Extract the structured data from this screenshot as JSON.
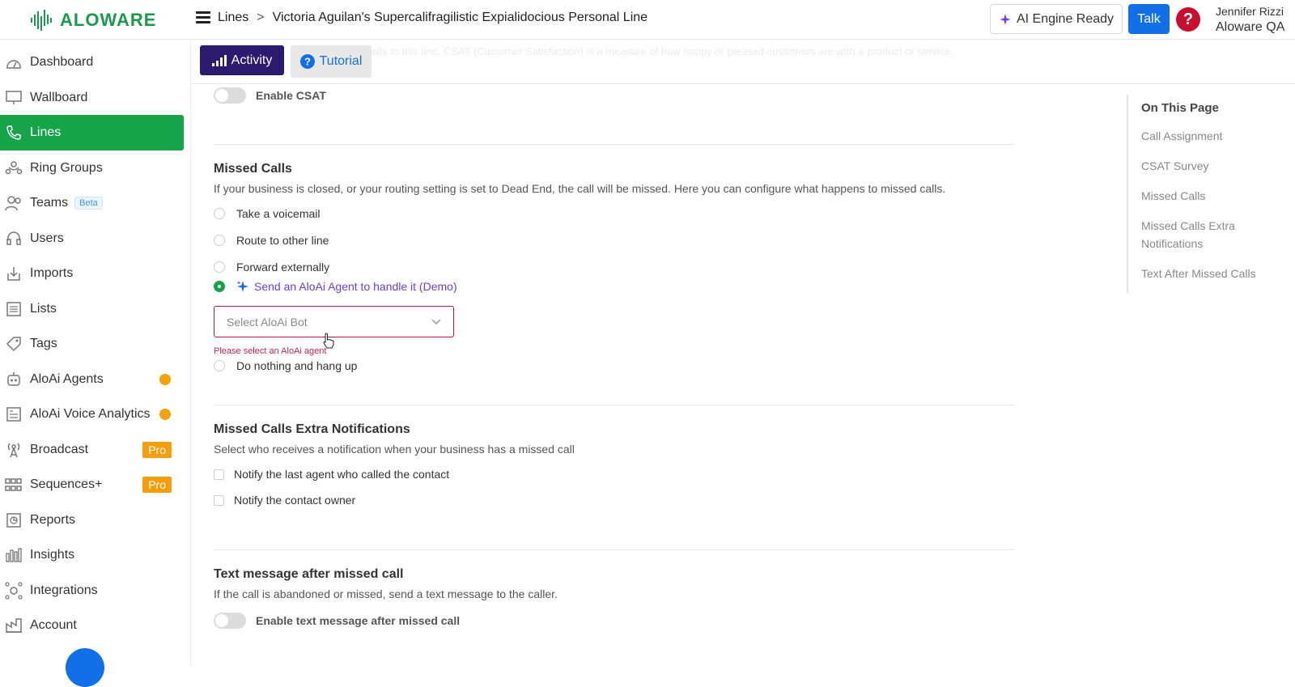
{
  "header": {
    "logo_text": "ALOWARE",
    "breadcrumb": [
      "Lines",
      ">",
      "Victoria Aguilan's Supercalifragilistic Expialidocious Personal Line"
    ],
    "ai_engine_label": "AI Engine Ready",
    "talk_label": "Talk",
    "help_glyph": "?",
    "user_name": "Jennifer Rizzi",
    "org_name": "Aloware QA"
  },
  "sidebar": {
    "items": [
      {
        "label": "Dashboard",
        "icon": "dashboard-icon"
      },
      {
        "label": "Wallboard",
        "icon": "monitor-icon"
      },
      {
        "label": "Lines",
        "icon": "phone-icon",
        "active": true
      },
      {
        "label": "Ring Groups",
        "icon": "ring-group-icon"
      },
      {
        "label": "Teams",
        "icon": "teams-icon",
        "badge": "Beta"
      },
      {
        "label": "Users",
        "icon": "headset-icon"
      },
      {
        "label": "Imports",
        "icon": "import-icon"
      },
      {
        "label": "Lists",
        "icon": "list-icon"
      },
      {
        "label": "Tags",
        "icon": "tag-icon"
      },
      {
        "label": "AloAi Agents",
        "icon": "robot-icon",
        "dot": true
      },
      {
        "label": "AloAi Voice Analytics",
        "icon": "analytics-icon",
        "dot": true
      },
      {
        "label": "Broadcast",
        "icon": "broadcast-icon",
        "badge": "Pro"
      },
      {
        "label": "Sequences+",
        "icon": "sequence-icon",
        "badge": "Pro"
      },
      {
        "label": "Reports",
        "icon": "report-icon"
      },
      {
        "label": "Insights",
        "icon": "insights-icon"
      },
      {
        "label": "Integrations",
        "icon": "integrations-icon"
      },
      {
        "label": "Account",
        "icon": "account-icon"
      }
    ]
  },
  "subbar": {
    "activity_label": "Activity",
    "tutorial_label": "Tutorial",
    "faded_text": "alls to this line. CSAT (Customer Satisfaction) is a measure of how happy or pleased customers are with a product or service."
  },
  "csat": {
    "toggle_label": "Enable CSAT"
  },
  "missed_calls": {
    "title": "Missed Calls",
    "description": "If your business is closed, or your routing setting is set to Dead End, the call will be missed. Here you can configure what happens to missed calls.",
    "options": [
      "Take a voicemail",
      "Route to other line",
      "Forward externally",
      "Send an AloAi Agent to handle it (Demo)",
      "Do nothing and hang up"
    ],
    "selected_option": "Send an AloAi Agent to handle it (Demo)",
    "select_placeholder": "Select AloAi Bot",
    "error": "Please select an AloAi agent"
  },
  "extra_notifications": {
    "title": "Missed Calls Extra Notifications",
    "description": "Select who receives a notification when your business has a missed call",
    "options": [
      "Notify the last agent who called the contact",
      "Notify the contact owner"
    ]
  },
  "text_after": {
    "title": "Text message after missed call",
    "description": "If the call is abandoned or missed, send a text message to the caller.",
    "toggle_label": "Enable text message after missed call"
  },
  "toc": {
    "title": "On This Page",
    "items": [
      "Call Assignment",
      "CSAT Survey",
      "Missed Calls",
      "Missed Calls Extra Notifications",
      "Text After Missed Calls"
    ]
  },
  "colors": {
    "brand_green": "#16a34a",
    "activity_purple": "#2b1a6e",
    "talk_blue": "#1170e8",
    "error_red": "#b5163f",
    "pro_orange": "#f59e0b"
  }
}
